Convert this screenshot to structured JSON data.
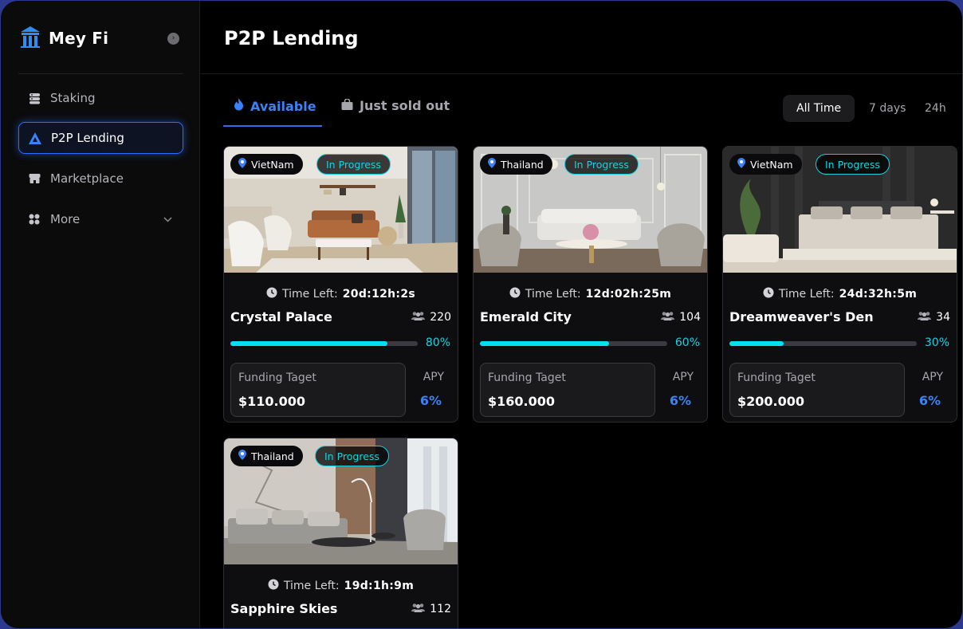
{
  "brand": {
    "name": "Mey Fi"
  },
  "sidebar": {
    "items": [
      {
        "label": "Staking",
        "icon": "database-icon"
      },
      {
        "label": "P2P Lending",
        "icon": "triangle-logo-icon",
        "active": true
      },
      {
        "label": "Marketplace",
        "icon": "store-icon"
      },
      {
        "label": "More",
        "icon": "grid-icon"
      }
    ]
  },
  "page": {
    "title": "P2P Lending"
  },
  "tabs": [
    {
      "label": "Available",
      "icon": "flame-icon",
      "active": true
    },
    {
      "label": "Just sold out",
      "icon": "bag-icon"
    }
  ],
  "filters": [
    {
      "label": "All Time",
      "active": true
    },
    {
      "label": "7 days"
    },
    {
      "label": "24h"
    }
  ],
  "cards": [
    {
      "location": "VietNam",
      "status": "In Progress",
      "time_label": "Time Left:",
      "time_value": "20d:12h:2s",
      "name": "Crystal Palace",
      "investors": "220",
      "progress": 0.84,
      "progress_label": "80%",
      "funding_label": "Funding Taget",
      "funding_value": "$110.000",
      "apy_label": "APY",
      "apy_value": "6%"
    },
    {
      "location": "Thailand",
      "status": "In Progress",
      "time_label": "Time Left:",
      "time_value": "12d:02h:25m",
      "name": "Emerald City",
      "investors": "104",
      "progress": 0.69,
      "progress_label": "60%",
      "funding_label": "Funding Taget",
      "funding_value": "$160.000",
      "apy_label": "APY",
      "apy_value": "6%"
    },
    {
      "location": "VietNam",
      "status": "In Progress",
      "time_label": "Time Left:",
      "time_value": "24d:32h:5m",
      "name": "Dreamweaver's Den",
      "investors": "34",
      "progress": 0.29,
      "progress_label": "30%",
      "funding_label": "Funding Taget",
      "funding_value": "$200.000",
      "apy_label": "APY",
      "apy_value": "6%"
    },
    {
      "location": "Thailand",
      "status": "In Progress",
      "time_label": "Time Left:",
      "time_value": "19d:1h:9m",
      "name": "Sapphire Skies",
      "investors": "112"
    }
  ],
  "colors": {
    "accent_blue": "#3b82f6",
    "accent_cyan": "#19d0e0",
    "progress": "#00e0f0"
  }
}
